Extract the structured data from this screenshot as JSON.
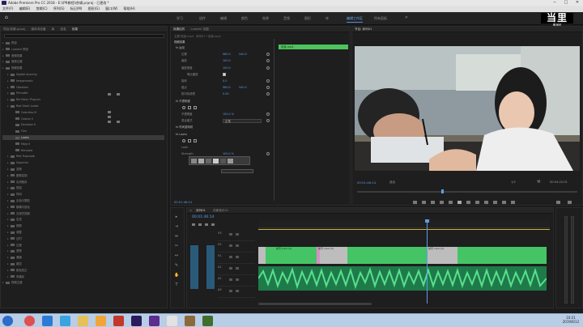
{
  "window": {
    "title": "Adobe Premiere Pro CC 2018 - E:\\\\PR教程\\\\剪辑.prproj - 已更改 *",
    "min": "─",
    "max": "□",
    "close": "✕"
  },
  "menu": [
    "文件(F)",
    "编辑(E)",
    "剪辑(C)",
    "序列(S)",
    "标记(M)",
    "图形(G)",
    "窗口(W)",
    "帮助(H)"
  ],
  "workspaces": [
    "学习",
    "组件",
    "编辑",
    "颜色",
    "效果",
    "音频",
    "图形",
    "库",
    "编辑工作区",
    "所有面板"
  ],
  "active_workspace": "编辑工作区",
  "logo": {
    "text": "当里",
    "sub": "奥润可",
    "code": "8138828"
  },
  "project": {
    "tabs": [
      "项目:剪辑.prproj",
      "媒体浏览器",
      "库",
      "信息",
      "效果"
    ],
    "rows": [
      {
        "label": "预设",
        "depth": 0
      },
      {
        "label": "Lumetri 预设",
        "depth": 0
      },
      {
        "label": "音频效果",
        "depth": 0
      },
      {
        "label": "音频过渡",
        "depth": 0
      },
      {
        "label": "视频效果",
        "depth": 0
      },
      {
        "label": "Digital Anarchy",
        "depth": 1
      },
      {
        "label": "Imagenomic",
        "depth": 1
      },
      {
        "label": "Obsidian",
        "depth": 1
      },
      {
        "label": "Primatte",
        "depth": 1
      },
      {
        "label": "Re:Vision Plug-ins",
        "depth": 1
      },
      {
        "label": "Red Giant Looks",
        "depth": 1
      },
      {
        "label": "Colorista IV",
        "depth": 2
      },
      {
        "label": "Cosmo II",
        "depth": 2
      },
      {
        "label": "Denoiser II",
        "depth": 2
      },
      {
        "label": "Film",
        "depth": 2
      },
      {
        "label": "Looks",
        "depth": 2,
        "selected": true
      },
      {
        "label": "Mojo II",
        "depth": 2
      },
      {
        "label": "Renoiser",
        "depth": 2
      },
      {
        "label": "Red Trapcode",
        "depth": 1
      },
      {
        "label": "Sapphire",
        "depth": 1
      },
      {
        "label": "变换",
        "depth": 1
      },
      {
        "label": "图像控制",
        "depth": 1
      },
      {
        "label": "实用程序",
        "depth": 1
      },
      {
        "label": "扭曲",
        "depth": 1
      },
      {
        "label": "时间",
        "depth": 1
      },
      {
        "label": "杂色与颗粒",
        "depth": 1
      },
      {
        "label": "模糊与锐化",
        "depth": 1
      },
      {
        "label": "沉浸式视频",
        "depth": 1
      },
      {
        "label": "生成",
        "depth": 1
      },
      {
        "label": "视频",
        "depth": 1
      },
      {
        "label": "调整",
        "depth": 1
      },
      {
        "label": "过时",
        "depth": 1
      },
      {
        "label": "过渡",
        "depth": 1
      },
      {
        "label": "透视",
        "depth": 1
      },
      {
        "label": "通道",
        "depth": 1
      },
      {
        "label": "键控",
        "depth": 1
      },
      {
        "label": "颜色校正",
        "depth": 1
      },
      {
        "label": "风格化",
        "depth": 1
      },
      {
        "label": "视频过渡",
        "depth": 0
      }
    ]
  },
  "effect_controls": {
    "tabs": [
      "效果控件",
      "Lumetri 范围"
    ],
    "source": "主要*前景.mp4 · 序列01 * 前景.mp4",
    "clip_label": "前景.mp4",
    "section": "视频效果",
    "rows": [
      {
        "label": "fx 运动",
        "indent": 0
      },
      {
        "label": "位置",
        "indent": 1,
        "value": "960.0",
        "value2": "540.0"
      },
      {
        "label": "缩放",
        "indent": 1,
        "value": "100.0"
      },
      {
        "label": "缩放宽度",
        "indent": 1,
        "value": "100.0"
      },
      {
        "label": "等比缩放",
        "indent": 2,
        "check": true
      },
      {
        "label": "旋转",
        "indent": 1,
        "value": "0.0"
      },
      {
        "label": "锚点",
        "indent": 1,
        "value": "960.0",
        "value2": "540.0"
      },
      {
        "label": "防闪烁滤镜",
        "indent": 1,
        "value": "0.00"
      },
      {
        "label": "fx 不透明度",
        "indent": 0
      },
      {
        "label": "",
        "indent": 1,
        "shapes": true
      },
      {
        "label": "不透明度",
        "indent": 1,
        "value": "100.0 %"
      },
      {
        "label": "混合模式",
        "indent": 1,
        "dropdown": "正常"
      },
      {
        "label": "fx 时间重映射",
        "indent": 0
      },
      {
        "label": "fx Looks",
        "indent": 0
      },
      {
        "label": "",
        "indent": 1,
        "shapes": true
      },
      {
        "label": "Look",
        "indent": 1
      },
      {
        "label": "Strength",
        "indent": 1,
        "value": "100.0 %"
      }
    ],
    "timecode": "00:01:46:14"
  },
  "program": {
    "title": "节目: 序列01",
    "timecode": "00:01:46:14",
    "fit": "适合",
    "quality": "1/2",
    "duration": "00:04:22:01"
  },
  "timeline": {
    "tab": "序列01",
    "tab2": "前景音乐01",
    "timecode": "00:01:46:14",
    "tracks": [
      {
        "name": "V3"
      },
      {
        "name": "V2"
      },
      {
        "name": "V1"
      },
      {
        "name": "A1"
      },
      {
        "name": "A2"
      },
      {
        "name": "A3"
      }
    ],
    "clip_labels": [
      "前景.mp4 [V]",
      "前景.mp4 [V]",
      "前景.mp4 [V]"
    ]
  },
  "taskbar": {
    "time": "10:21",
    "date": "2019/6/12"
  }
}
